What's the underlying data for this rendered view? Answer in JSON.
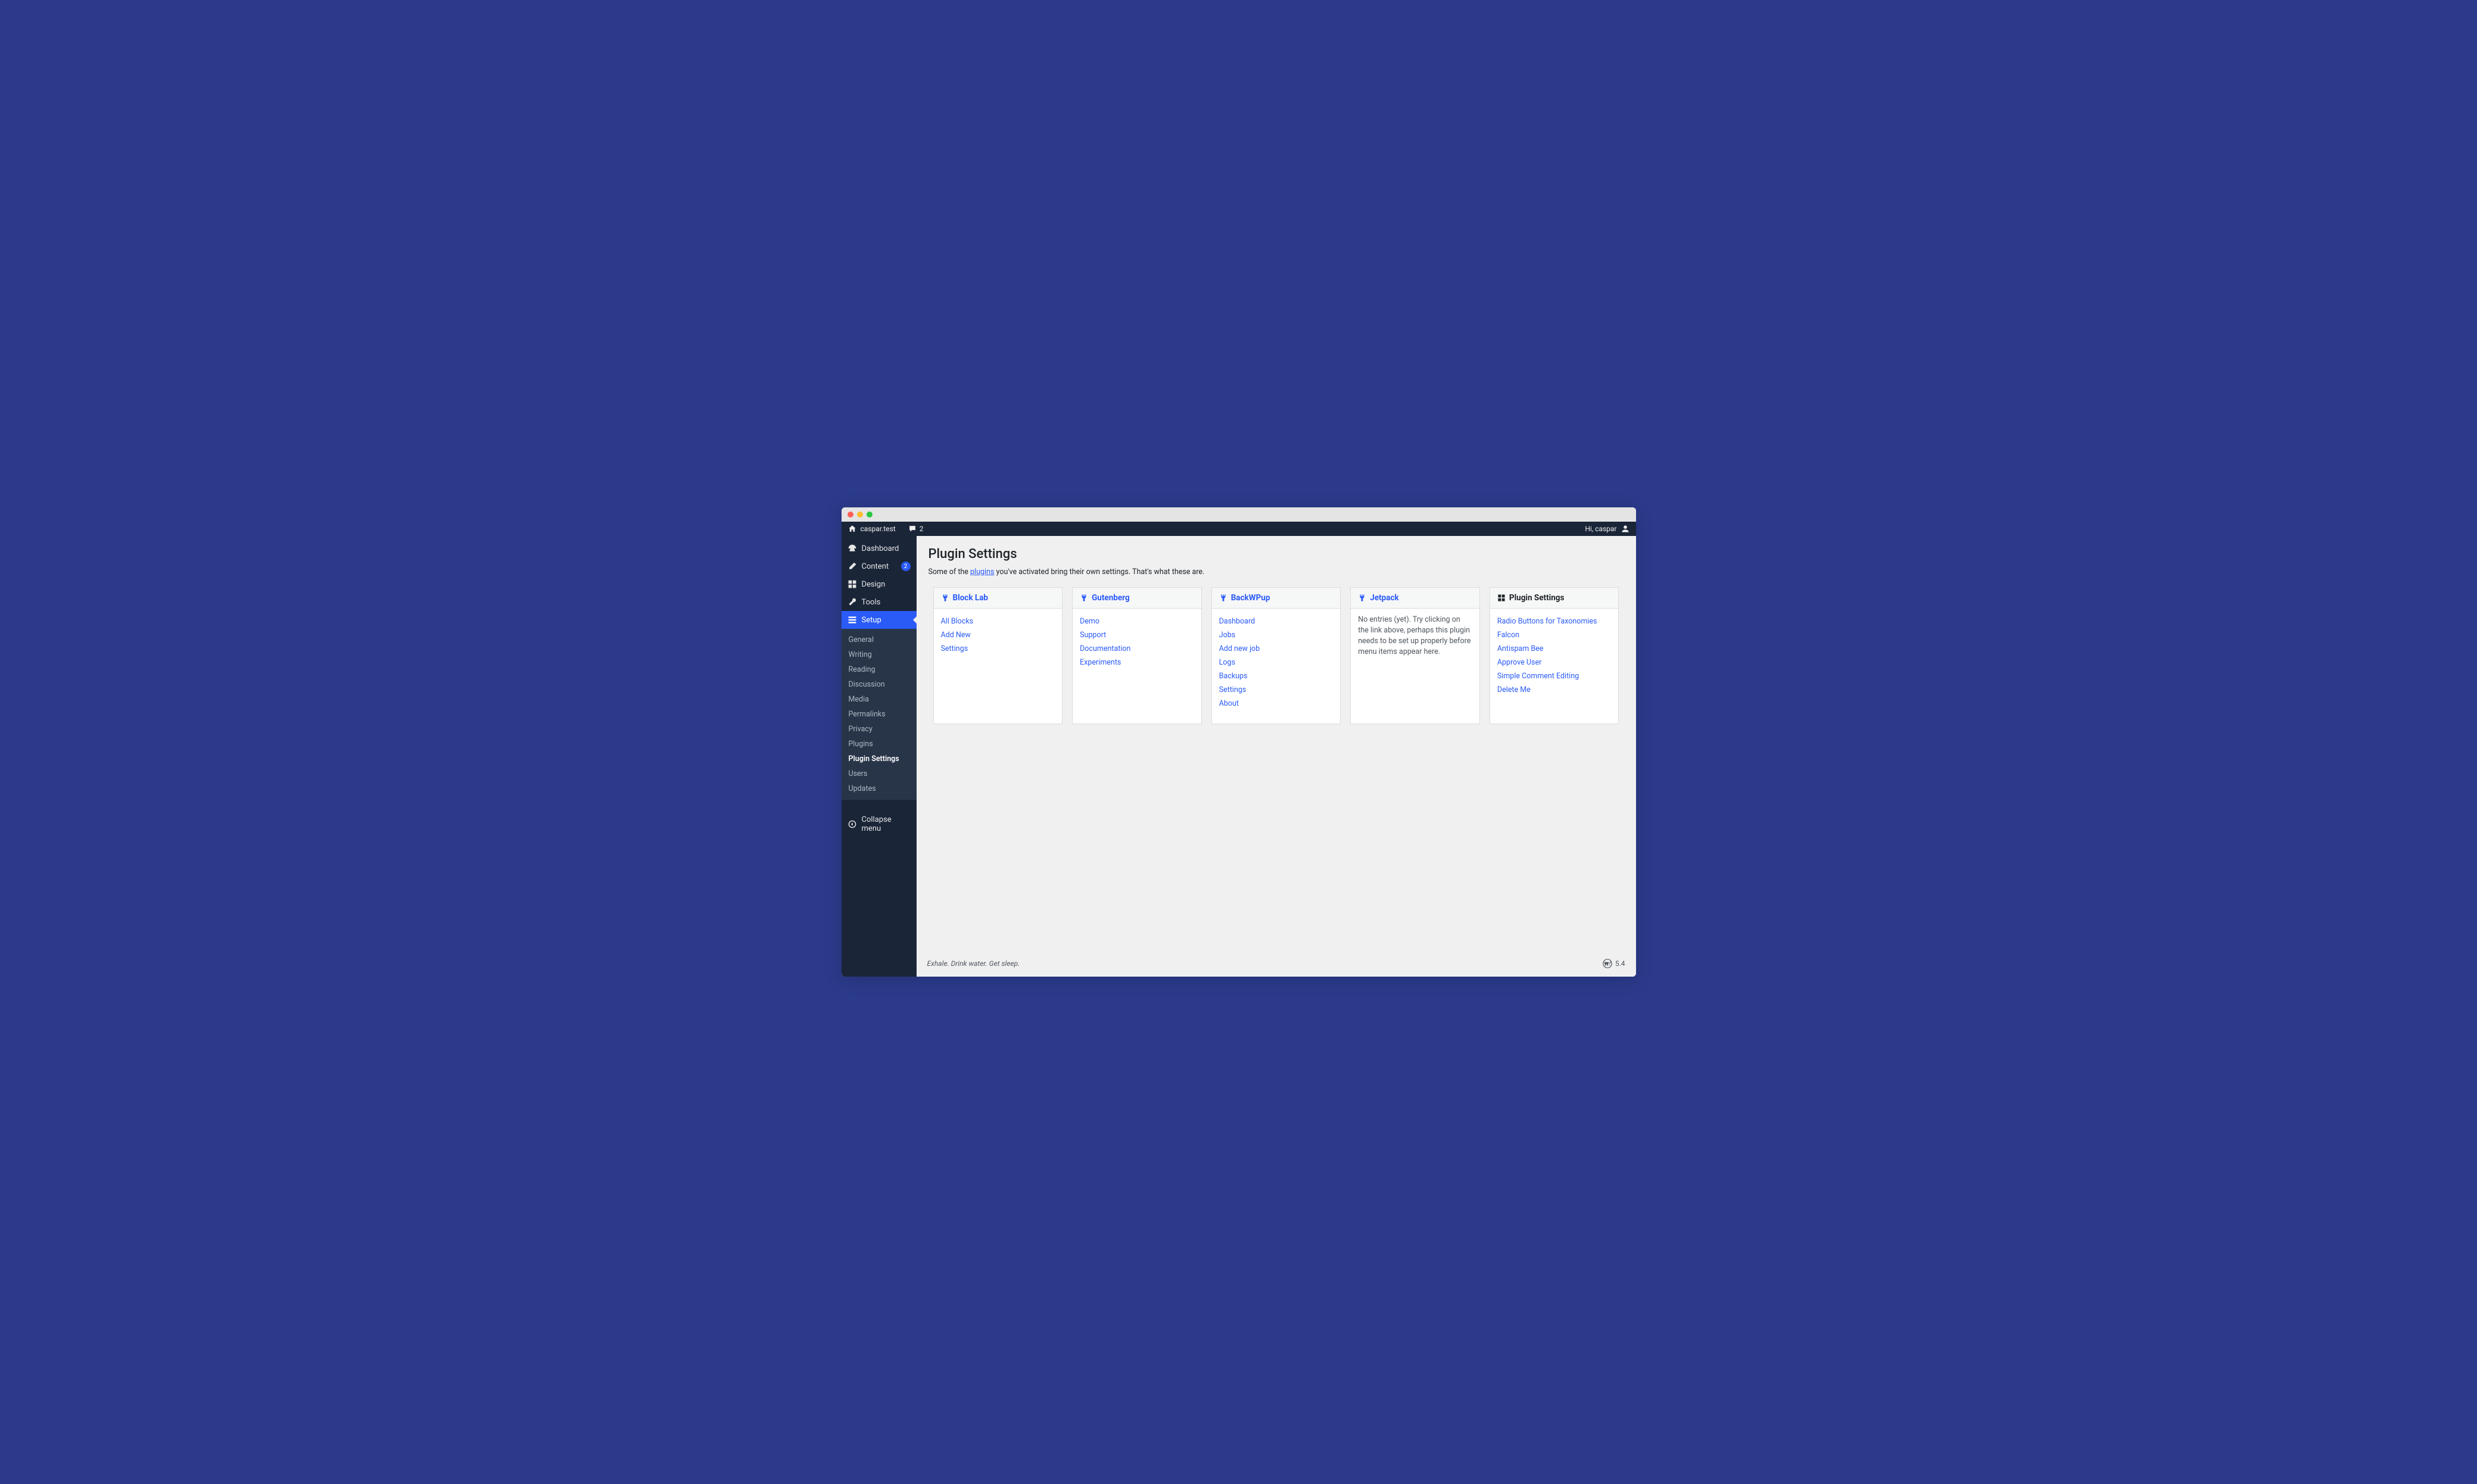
{
  "toolbar": {
    "site_name": "caspar.test",
    "comment_count": "2",
    "greeting": "Hi, caspar"
  },
  "sidebar": {
    "items": [
      {
        "label": "Dashboard"
      },
      {
        "label": "Content",
        "badge": "2"
      },
      {
        "label": "Design"
      },
      {
        "label": "Tools"
      },
      {
        "label": "Setup"
      }
    ],
    "submenu": [
      {
        "label": "General"
      },
      {
        "label": "Writing"
      },
      {
        "label": "Reading"
      },
      {
        "label": "Discussion"
      },
      {
        "label": "Media"
      },
      {
        "label": "Permalinks"
      },
      {
        "label": "Privacy"
      },
      {
        "label": "Plugins"
      },
      {
        "label": "Plugin Settings",
        "active": true
      },
      {
        "label": "Users"
      },
      {
        "label": "Updates"
      }
    ],
    "collapse_label": "Collapse menu"
  },
  "page": {
    "title": "Plugin Settings",
    "intro_before": "Some of the ",
    "intro_link": "plugins",
    "intro_after": " you've activated bring their own settings. That's what these are."
  },
  "cards": [
    {
      "title": "Block Lab",
      "icon": "plug-icon",
      "title_style": "link",
      "links": [
        "All Blocks",
        "Add New",
        "Settings"
      ]
    },
    {
      "title": "Gutenberg",
      "icon": "plug-icon",
      "title_style": "link",
      "links": [
        "Demo",
        "Support",
        "Documentation",
        "Experiments"
      ]
    },
    {
      "title": "BackWPup",
      "icon": "plug-icon",
      "title_style": "link",
      "links": [
        "Dashboard",
        "Jobs",
        "Add new job",
        "Logs",
        "Backups",
        "Settings",
        "About"
      ]
    },
    {
      "title": "Jetpack",
      "icon": "plug-icon",
      "title_style": "link",
      "empty": "No entries (yet). Try clicking on the link above, perhaps this plugin needs to be set up properly before menu items appear here."
    },
    {
      "title": "Plugin Settings",
      "icon": "grid-icon",
      "title_style": "dark",
      "links": [
        "Radio Buttons for Taxonomies",
        "Falcon",
        "Antispam Bee",
        "Approve User",
        "Simple Comment Editing",
        "Delete Me"
      ]
    }
  ],
  "footer": {
    "left": "Exhale. Drink water. Get sleep.",
    "version": "5.4"
  }
}
